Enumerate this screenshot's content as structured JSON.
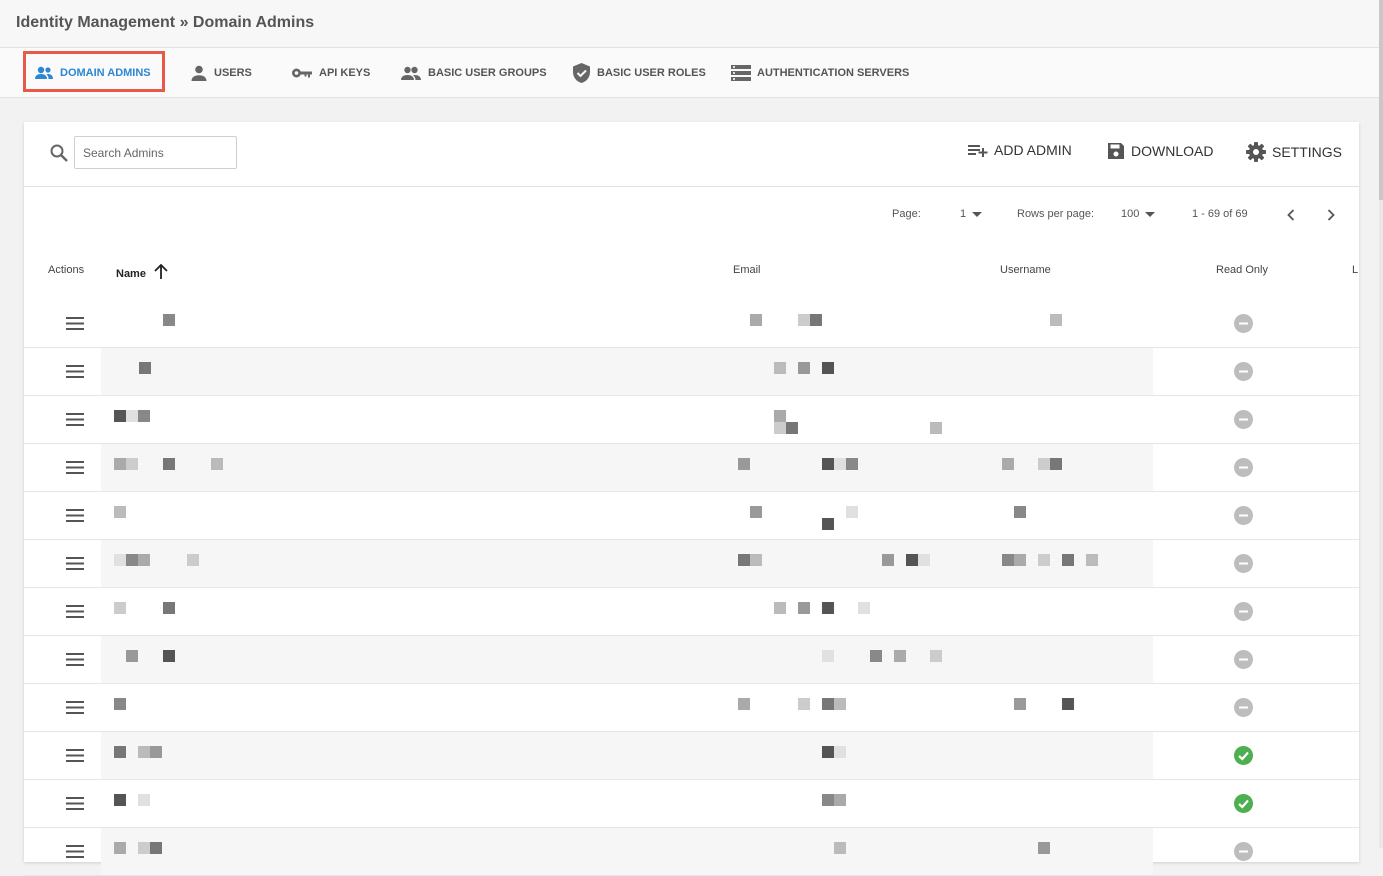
{
  "breadcrumb": "Identity Management » Domain Admins",
  "tabs": [
    {
      "label": "DOMAIN ADMINS",
      "icon": "admins-icon",
      "active": true
    },
    {
      "label": "USERS",
      "icon": "user-icon",
      "active": false
    },
    {
      "label": "API KEYS",
      "icon": "key-icon",
      "active": false
    },
    {
      "label": "BASIC USER GROUPS",
      "icon": "group-icon",
      "active": false
    },
    {
      "label": "BASIC USER ROLES",
      "icon": "shield-icon",
      "active": false
    },
    {
      "label": "AUTHENTICATION SERVERS",
      "icon": "server-icon",
      "active": false
    }
  ],
  "toolbar": {
    "search_placeholder": "Search Admins",
    "add_admin": "ADD ADMIN",
    "download": "DOWNLOAD",
    "settings": "SETTINGS"
  },
  "pagination": {
    "page_label": "Page:",
    "page_value": "1",
    "rows_label": "Rows per page:",
    "rows_value": "100",
    "range": "1 - 69 of 69"
  },
  "columns": {
    "actions": "Actions",
    "name": "Name",
    "email": "Email",
    "username": "Username",
    "read_only": "Read Only",
    "last": "L"
  },
  "rows": [
    {
      "read_only": false
    },
    {
      "read_only": false
    },
    {
      "read_only": false
    },
    {
      "read_only": false
    },
    {
      "read_only": false
    },
    {
      "read_only": false
    },
    {
      "read_only": false
    },
    {
      "read_only": false
    },
    {
      "read_only": false
    },
    {
      "read_only": true
    },
    {
      "read_only": true
    },
    {
      "read_only": false
    }
  ],
  "colors": {
    "accent": "#2b87d4",
    "highlight": "#e85a47",
    "check": "#4caf50",
    "minus": "#bdbdbd"
  }
}
